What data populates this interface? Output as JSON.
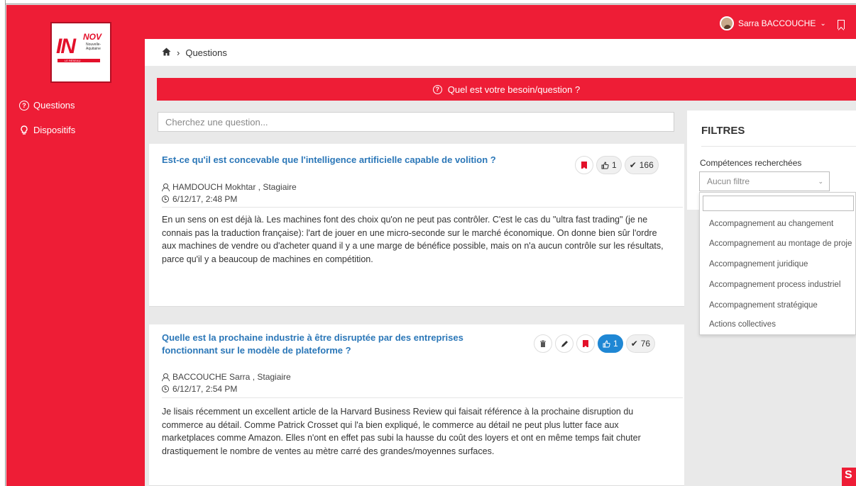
{
  "logo": {
    "main": "IN",
    "nov": "NOV",
    "sub1": "Nouvelle-",
    "sub2": "Aquitaine",
    "bar": "LE RÉSEAU"
  },
  "sidebar": {
    "items": [
      {
        "label": "Questions"
      },
      {
        "label": "Dispositifs"
      }
    ]
  },
  "user": {
    "name": "Sarra BACCOUCHE"
  },
  "breadcrumb": {
    "current": "Questions"
  },
  "banner": {
    "text": "Quel est votre besoin/question ?"
  },
  "search": {
    "placeholder": "Cherchez une question..."
  },
  "questions": [
    {
      "title": "Est-ce qu'il est concevable que l'intelligence artificielle capable de volition ?",
      "author": "HAMDOUCH Mokhtar , Stagiaire",
      "date": "6/12/17, 2:48 PM",
      "likes": "1",
      "answers": "166",
      "body": "En un sens on est déjà là. Les machines font des choix qu'on ne peut pas contrôler. C'est le cas du \"ultra fast trading\" (je ne connais pas la traduction française): l'art de jouer en une micro-seconde sur le marché économique. On donne bien sûr l'ordre aux machines de vendre ou d'acheter quand il y a une marge de bénéfice possible, mais on n'a aucun contrôle sur les résultats, parce qu'il y a beaucoup de machines en compétition."
    },
    {
      "title_line1": "Quelle est la prochaine industrie à être disruptée par des entreprises",
      "title_line2": "fonctionnant sur le modèle de plateforme ?",
      "author": "BACCOUCHE Sarra , Stagiaire",
      "date": "6/12/17, 2:54 PM",
      "likes": "1",
      "answers": "76",
      "body": "Je lisais récemment un excellent article de la Harvard Business Review qui faisait référence à la prochaine disruption du commerce au détail. Comme Patrick Crosset qui l'a bien expliqué, le commerce au détail ne peut plus lutter face aux marketplaces comme Amazon. Elles n'ont en effet pas subi la hausse du coût des loyers et ont en même temps fait chuter drastiquement le nombre de ventes au mètre carré des grandes/moyennes surfaces."
    }
  ],
  "filters": {
    "title": "FILTRES",
    "label": "Compétences recherchées",
    "selected": "Aucun filtre",
    "options": [
      "Accompagnement au changement",
      "Accompagnement au montage de proje",
      "Accompagnement juridique",
      "Accompagnement process industriel",
      "Accompagnement stratégique",
      "Actions collectives"
    ]
  },
  "colors": {
    "brand_red": "#ee1d36",
    "link_blue": "#2b77b8",
    "like_blue": "#1f87d4"
  }
}
